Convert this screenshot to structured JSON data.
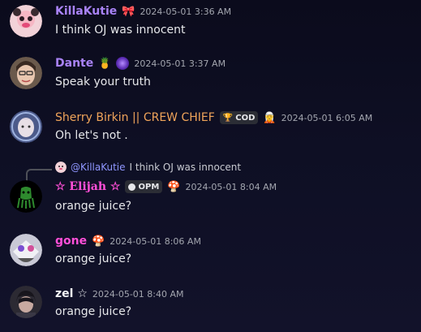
{
  "messages": [
    {
      "username": "KillaKutie",
      "username_color": "#a983f7",
      "timestamp": "2024-05-01 3:36 AM",
      "text": "I think OJ was innocent",
      "badge_icon": "pink-ribbon-icon"
    },
    {
      "username": "Dante",
      "username_color": "#a983f7",
      "emoji": "🍍",
      "timestamp": "2024-05-01 3:37 AM",
      "text": "Speak your truth",
      "badge_icon": "purple-orb-icon"
    },
    {
      "username": "Sherry Birkin || CREW CHIEF",
      "username_color": "#f0a45a",
      "tag_label": "COD",
      "tag_icon": "trophy-icon",
      "timestamp": "2024-05-01 6:05 AM",
      "text": "Oh let's not .",
      "badge_icon": "figure-icon"
    },
    {
      "reply": {
        "mention": "@KillaKutie",
        "text": "I think OJ was innocent"
      },
      "username": "☆ Elijah ☆",
      "username_color": "#ff4fd8",
      "tag_label": "OPM",
      "tag_icon": "logo-icon",
      "timestamp": "2024-05-01 8:04 AM",
      "text": "orange juice?",
      "badge_icon": "mushroom-icon"
    },
    {
      "username": "gone",
      "username_color": "#ff4fd8",
      "timestamp": "2024-05-01 8:06 AM",
      "text": "orange juice?",
      "badge_icon": "mushroom-icon"
    },
    {
      "username": "zel ☆",
      "username_color": "#f2f3f5",
      "timestamp": "2024-05-01 8:40 AM",
      "text": "orange juice?"
    }
  ]
}
